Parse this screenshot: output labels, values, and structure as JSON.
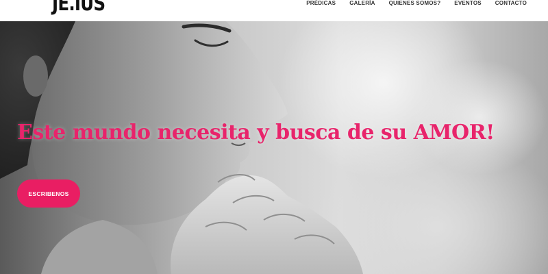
{
  "header": {
    "logo_text": "JE.IUS",
    "nav": [
      {
        "label": "PRÉDICAS"
      },
      {
        "label": "GALERÍA"
      },
      {
        "label": "QUIENES SOMOS?"
      },
      {
        "label": "EVENTOS"
      },
      {
        "label": "CONTACTO"
      }
    ]
  },
  "hero": {
    "headline": "Este mundo necesita y busca de su AMOR!",
    "cta_label": "ESCRIBENOS",
    "colors": {
      "accent": "#e91e63",
      "headline": "#e8246b"
    }
  }
}
